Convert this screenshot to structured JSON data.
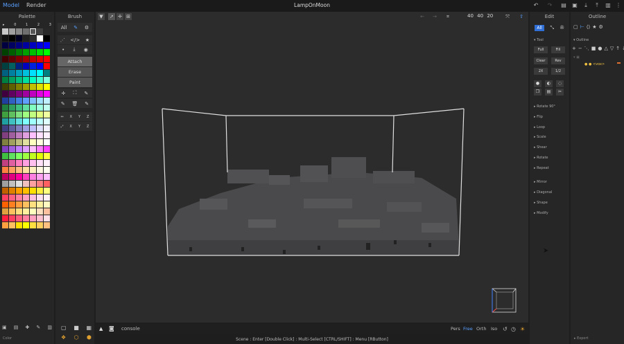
{
  "app": {
    "title": "LampOnMoon",
    "modes": [
      "Model",
      "Render"
    ]
  },
  "panels": {
    "palette": "Palette",
    "brush": "Brush",
    "edit": "Edit",
    "outline": "Outline"
  },
  "palette": {
    "tabs": [
      "▸",
      "0",
      "1",
      "2",
      "3"
    ],
    "footer_label": "Color",
    "colors": [
      "#c8c8c8",
      "#a0a0a0",
      "#888888",
      "#707070",
      "#585858",
      "#404040",
      "#282828",
      "#101010",
      "#000000",
      "#000020",
      "#202020",
      "#303030",
      "#ffffff",
      "#000000",
      "#000040",
      "#000060",
      "#000080",
      "#0000a0",
      "#0000c0",
      "#0000e0",
      "#0000ff",
      "#004000",
      "#006000",
      "#008000",
      "#00a000",
      "#00c000",
      "#00e000",
      "#00ff00",
      "#400000",
      "#600000",
      "#800000",
      "#a00000",
      "#c00000",
      "#e00000",
      "#ff0000",
      "#004040",
      "#006060",
      "#002080",
      "#0000c0",
      "#0020e0",
      "#0000ff",
      "#ff0000",
      "#006080",
      "#0080a0",
      "#00a0c0",
      "#00c0e0",
      "#00e0ff",
      "#00ffff",
      "#008080",
      "#008040",
      "#00a060",
      "#00c080",
      "#00e0a0",
      "#00ffc0",
      "#40ffd0",
      "#80ffe0",
      "#404000",
      "#606000",
      "#808000",
      "#a0a000",
      "#c0c000",
      "#e0e000",
      "#ffff00",
      "#400040",
      "#600060",
      "#800080",
      "#a000a0",
      "#c000c0",
      "#e000e0",
      "#ff00ff",
      "#2040a0",
      "#3060c0",
      "#4080e0",
      "#60a0ff",
      "#80c0ff",
      "#a0e0ff",
      "#c0f0ff",
      "#208040",
      "#30a060",
      "#40c080",
      "#60e0a0",
      "#80ffc0",
      "#a0ffe0",
      "#c0fff0",
      "#40a040",
      "#60c060",
      "#80e080",
      "#a0ff80",
      "#c0ff80",
      "#e0ff80",
      "#f0ffa0",
      "#20a0a0",
      "#40c0c0",
      "#60e0e0",
      "#80ffff",
      "#a0ffff",
      "#c0ffff",
      "#e0ffff",
      "#404080",
      "#6060a0",
      "#8080c0",
      "#a0a0e0",
      "#c0c0ff",
      "#e0e0ff",
      "#f0f0ff",
      "#804080",
      "#a060a0",
      "#c080c0",
      "#e0a0e0",
      "#ffc0ff",
      "#ffe0ff",
      "#fff0ff",
      "#808040",
      "#a0a060",
      "#c0c080",
      "#e0e0a0",
      "#ffffc0",
      "#ffffe0",
      "#ffffff",
      "#8040c0",
      "#a060e0",
      "#c080ff",
      "#e0a0ff",
      "#ffc0ff",
      "#ff80ff",
      "#ff40ff",
      "#40c040",
      "#60e060",
      "#80ff60",
      "#a0ff40",
      "#c0ff20",
      "#e0ff00",
      "#ffff40",
      "#c04080",
      "#e060a0",
      "#ff80c0",
      "#ffa0e0",
      "#ffc0f0",
      "#ffe0f8",
      "#fff0fc",
      "#ff8040",
      "#ffa060",
      "#ffc080",
      "#ffe0a0",
      "#fff0c0",
      "#fff8e0",
      "#fffcf0",
      "#c00060",
      "#e00080",
      "#ff00a0",
      "#ff40c0",
      "#ff80e0",
      "#ffa0f0",
      "#ffc0ff",
      "#a0a0a0",
      "#c0c0c0",
      "#e0e0e0",
      "#f0c0c0",
      "#ffa0a0",
      "#ff8080",
      "#ff6060",
      "#c06000",
      "#e08000",
      "#ffa000",
      "#ffc000",
      "#ffe000",
      "#fff040",
      "#ffff80",
      "#ff4060",
      "#ff6080",
      "#ff80a0",
      "#ffa0c0",
      "#ffc0e0",
      "#ffe0f0",
      "#fff0f8",
      "#ff6000",
      "#ff8020",
      "#ffa040",
      "#ffc060",
      "#ffe080",
      "#fff0a0",
      "#fff8c0",
      "#e0a040",
      "#ffc060",
      "#ffe080",
      "#fff0a0",
      "#ffffc0",
      "#ffe0c0",
      "#ffc0a0",
      "#ff2040",
      "#ff4060",
      "#ff6080",
      "#ff80a0",
      "#ffa0c0",
      "#ffc0d0",
      "#ffe0e8",
      "#ffa040",
      "#ffc060",
      "#ffe000",
      "#ffff00",
      "#ffe040",
      "#ffd060",
      "#ffc080"
    ],
    "selected": 4
  },
  "brush": {
    "all_label": "All",
    "row1": [
      "✎",
      "⇠",
      "★"
    ],
    "row2": [
      "⋰",
      "</>",
      "★"
    ],
    "row3": [
      "•",
      "⤓",
      "◉"
    ],
    "buttons": [
      "Attach",
      "Erase",
      "Paint"
    ],
    "row4": [
      "✛",
      "⛶",
      "✎"
    ],
    "row5": [
      "✎",
      "🗑",
      "✎"
    ],
    "row6": [
      "↔",
      "X",
      "Y",
      "Z"
    ],
    "row7": [
      "⤢",
      "X",
      "Y",
      "Z"
    ]
  },
  "viewport": {
    "dims": [
      "40",
      "40",
      "20"
    ],
    "console_placeholder": "console",
    "view_modes": [
      "Pers",
      "Free",
      "Orth",
      "Iso"
    ],
    "active_view": "Free"
  },
  "status": "Scene : Enter [Double Click] : Multi-Select [CTRL/SHIFT] : Menu [RButton]",
  "edit": {
    "all_label": "All",
    "tool_label": "Tool",
    "buttons": [
      [
        "Full",
        "Fill"
      ],
      [
        "Clear",
        "Rev"
      ],
      [
        "2X",
        "1/2"
      ]
    ],
    "sections": [
      "Rotate 90°",
      "Flip",
      "Loop",
      "Scale",
      "Shear",
      "Rotate",
      "Repeat",
      "Mirror",
      "Diagonal",
      "Shape",
      "Modify"
    ]
  },
  "outline": {
    "header": "Outline",
    "item": "<vox>",
    "footer_label": "Export"
  }
}
